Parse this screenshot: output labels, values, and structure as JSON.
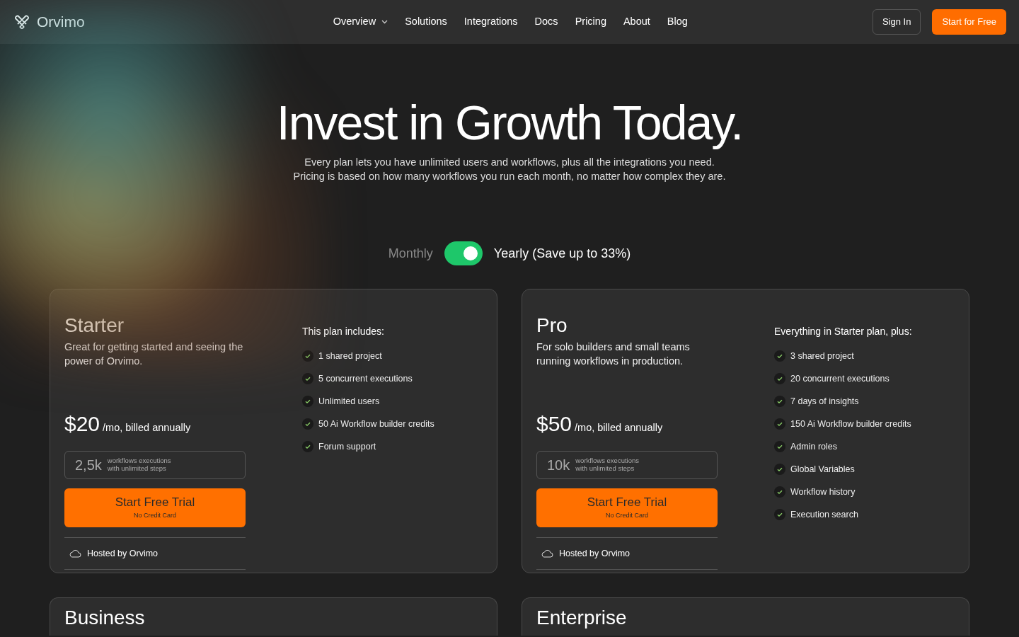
{
  "navbar": {
    "brand": "Orvimo",
    "links": [
      {
        "label": "Overview",
        "dropdown": true
      },
      {
        "label": "Solutions",
        "dropdown": false
      },
      {
        "label": "Integrations",
        "dropdown": false
      },
      {
        "label": "Docs",
        "dropdown": false
      },
      {
        "label": "Pricing",
        "dropdown": false
      },
      {
        "label": "About",
        "dropdown": false
      },
      {
        "label": "Blog",
        "dropdown": false
      }
    ],
    "sign_in": "Sign In",
    "cta": "Start for Free"
  },
  "hero": {
    "title": "Invest in Growth Today.",
    "lines": [
      "Every plan lets you have unlimited users and workflows, plus all the integrations you need.",
      "Pricing is based on how many workflows you run each month, no matter how complex they are."
    ]
  },
  "billing": {
    "monthly_label": "Monthly",
    "yearly_label": "Yearly (Save up to 33%)",
    "yearly": true
  },
  "plans": [
    {
      "name": "Starter",
      "description": "Great for getting started and seeing the power of Orvimo.",
      "price": "$20",
      "period": "/mo, billed annually",
      "executions": "2,5k",
      "executions_note": [
        "workflows executions",
        "with unlimited steps"
      ],
      "button": "Start Free Trial",
      "button_note": "No Credit Card",
      "hosting": "Hosted by Orvimo",
      "features_title": "This plan includes:",
      "features": [
        "1 shared project",
        "5 concurrent executions",
        "Unlimited users",
        "50 Ai Workflow builder credits",
        "Forum support"
      ]
    },
    {
      "name": "Pro",
      "description": "For solo builders and small teams running workflows in production.",
      "price": "$50",
      "period": "/mo, billed annually",
      "executions": "10k",
      "executions_note": [
        "workflows executions",
        "with unlimited steps"
      ],
      "button": "Start Free Trial",
      "button_note": "No Credit Card",
      "hosting": "Hosted by Orvimo",
      "features_title": "Everything in Starter plan, plus:",
      "features": [
        "3 shared project",
        "20 concurrent executions",
        "7 days of insights",
        "150 Ai Workflow builder credits",
        "Admin roles",
        "Global Variables",
        "Workflow history",
        "Execution search"
      ]
    },
    {
      "name": "Business"
    },
    {
      "name": "Enterprise"
    }
  ]
}
